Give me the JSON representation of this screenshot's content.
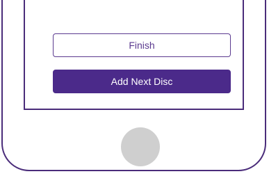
{
  "screen": {
    "finish_label": "Finish",
    "add_next_disc_label": "Add Next Disc"
  },
  "colors": {
    "accent": "#4b2a8a",
    "frame": "#4a2c7a",
    "home_button": "#cfcfcf"
  }
}
